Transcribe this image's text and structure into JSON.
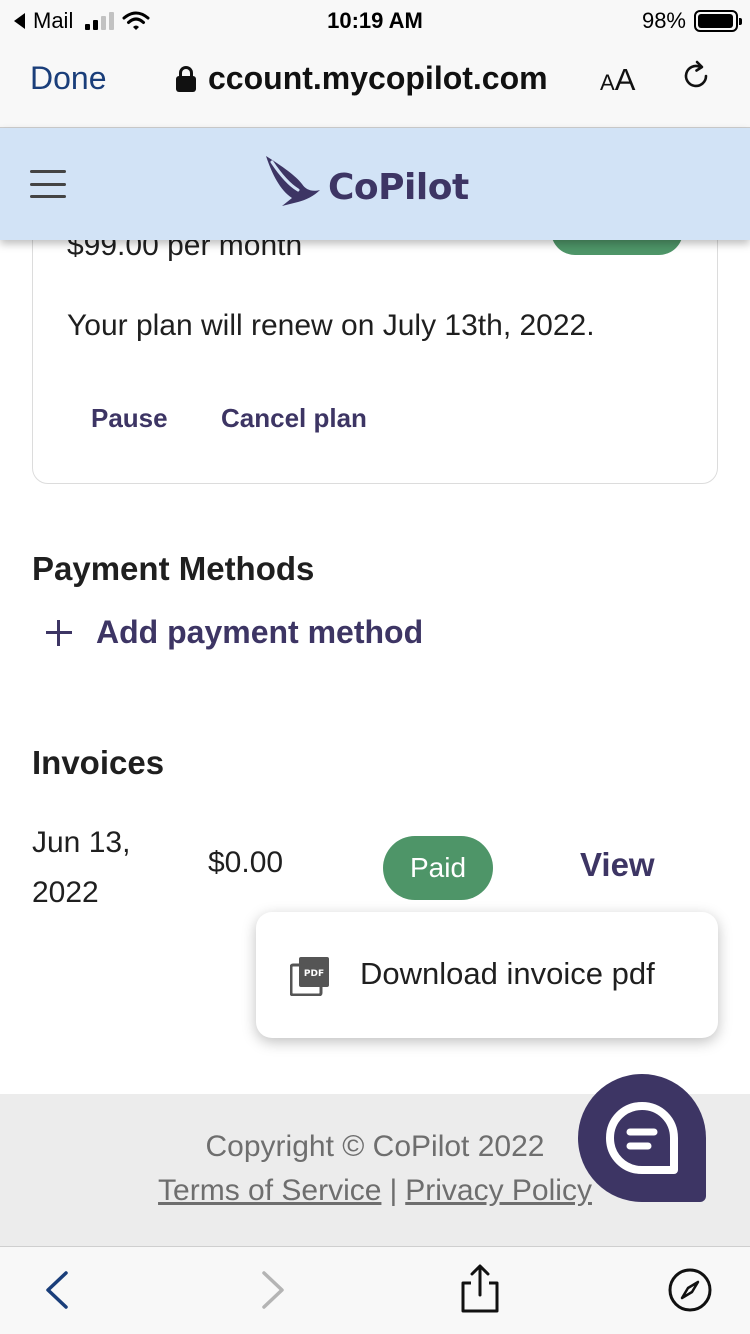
{
  "status_bar": {
    "back_app": "Mail",
    "time": "10:19 AM",
    "battery": "98%",
    "battery_fraction": 0.98
  },
  "browser": {
    "done_label": "Done",
    "url": "ccount.mycopilot.com",
    "aa_small": "A",
    "aa_big": "A"
  },
  "header": {
    "logo_text": "CoPilot",
    "brand_color": "#3d3564",
    "header_bg": "#d2e3f6"
  },
  "plan": {
    "price": "$99.00 per month",
    "renew_text": "Your plan will renew on July 13th, 2022.",
    "pause_label": "Pause",
    "cancel_label": "Cancel plan"
  },
  "payment_methods": {
    "title": "Payment Methods",
    "add_label": "Add payment method"
  },
  "invoices": {
    "title": "Invoices",
    "rows": [
      {
        "date": "Jun 13, 2022",
        "amount": "$0.00",
        "status": "Paid",
        "action": "View"
      }
    ],
    "status_color": "#4e9568"
  },
  "dropdown": {
    "items": [
      {
        "label": "Download invoice pdf",
        "icon": "pdf-icon"
      }
    ]
  },
  "footer": {
    "copyright": "Copyright © CoPilot 2022",
    "terms": "Terms of Service",
    "separator": "|",
    "privacy": "Privacy Policy"
  }
}
